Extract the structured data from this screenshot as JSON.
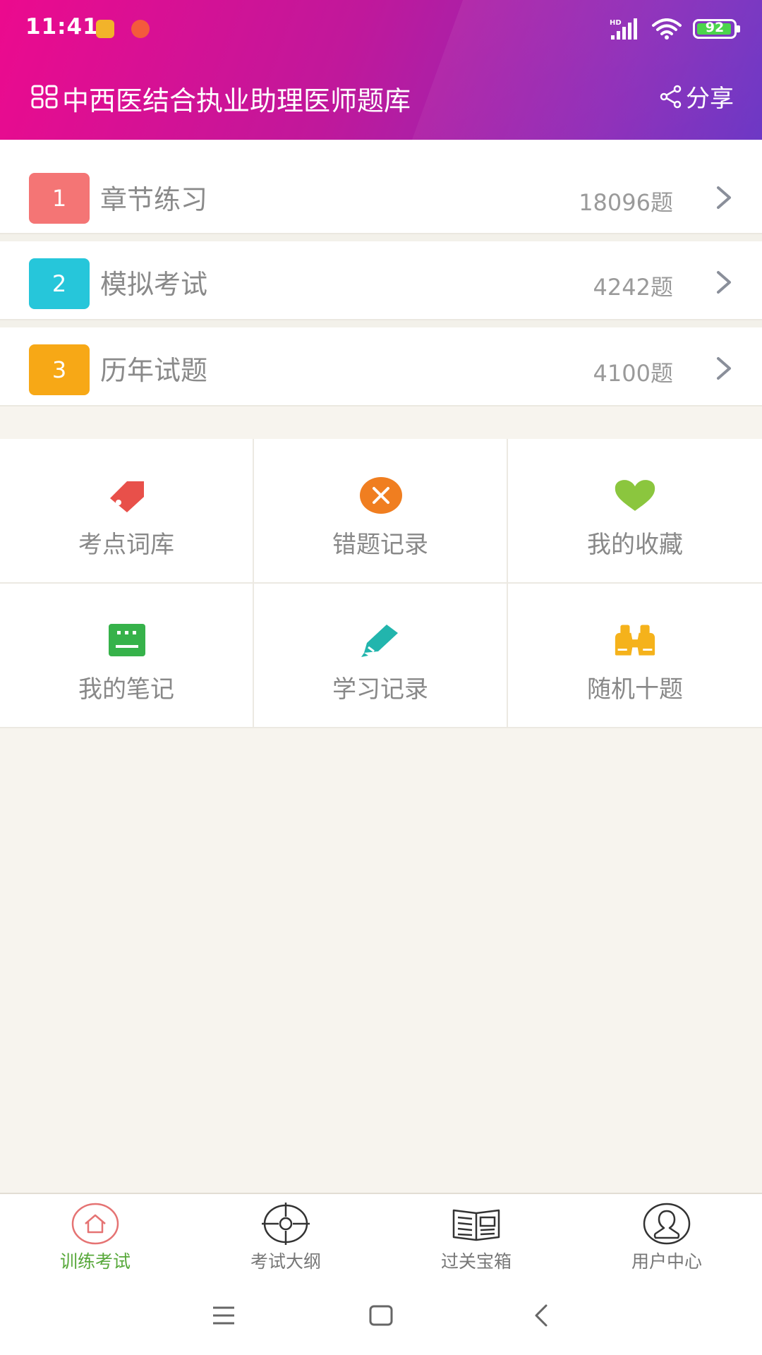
{
  "status_bar": {
    "time": "11:41",
    "network": "HD",
    "battery": "92"
  },
  "header": {
    "title": "中西医结合执业助理医师题库",
    "share_label": "分享"
  },
  "list": [
    {
      "number": "1",
      "label": "章节练习",
      "count": "18096题",
      "color": "#f47575"
    },
    {
      "number": "2",
      "label": "模拟考试",
      "count": "4242题",
      "color": "#26c6da"
    },
    {
      "number": "3",
      "label": "历年试题",
      "count": "4100题",
      "color": "#f7a816"
    }
  ],
  "grid": [
    {
      "label": "考点词库",
      "icon": "tag-icon",
      "color": "#e8504a"
    },
    {
      "label": "错题记录",
      "icon": "close-circle-icon",
      "color": "#f07e20"
    },
    {
      "label": "我的收藏",
      "icon": "heart-icon",
      "color": "#8bc63e"
    },
    {
      "label": "我的笔记",
      "icon": "notebook-icon",
      "color": "#36b24a"
    },
    {
      "label": "学习记录",
      "icon": "pencil-icon",
      "color": "#22b5ad"
    },
    {
      "label": "随机十题",
      "icon": "binoculars-icon",
      "color": "#f5b21b"
    }
  ],
  "tabbar": [
    {
      "label": "训练考试",
      "icon": "home-icon",
      "active": true
    },
    {
      "label": "考试大纲",
      "icon": "crosshair-icon",
      "active": false
    },
    {
      "label": "过关宝箱",
      "icon": "newspaper-icon",
      "active": false
    },
    {
      "label": "用户中心",
      "icon": "user-icon",
      "active": false
    }
  ],
  "accent_color": "#57a83a"
}
